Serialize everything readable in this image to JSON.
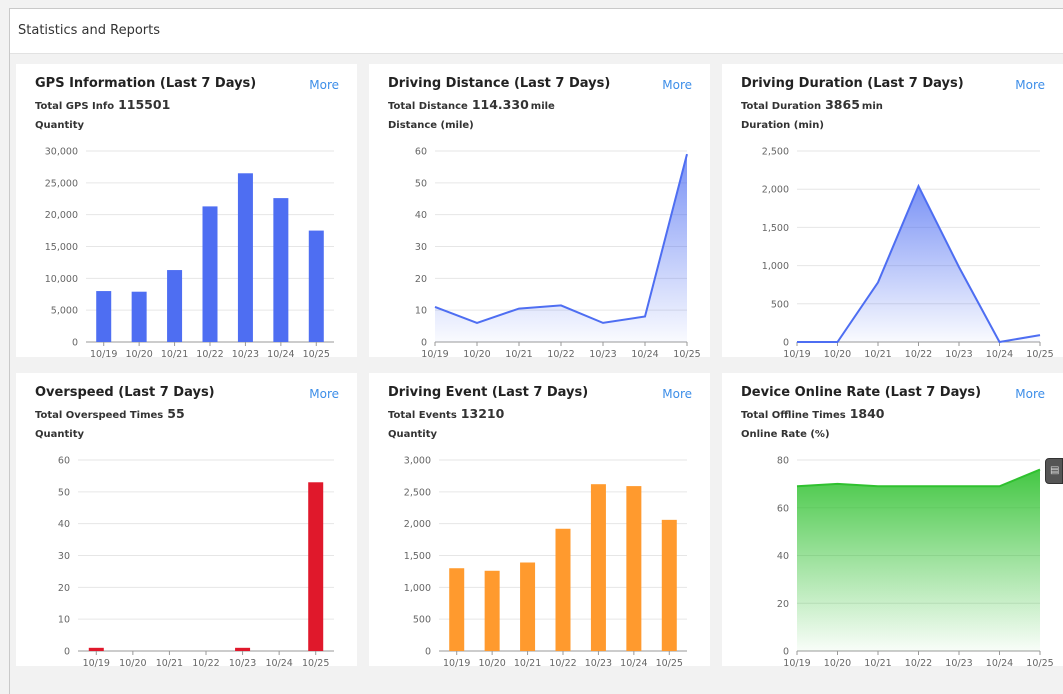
{
  "page": {
    "title": "Statistics and Reports",
    "side_button_icon": "▤"
  },
  "colors": {
    "blue": "#4e6ef2",
    "red": "#e0182b",
    "orange": "#ff9a2e",
    "green": "#2fc12f",
    "grid": "#e6e6e6",
    "axis": "#999999",
    "tick_text": "#666666"
  },
  "cards": [
    {
      "id": "gps",
      "title": "GPS Information (Last 7 Days)",
      "more": "More",
      "total_label": "Total GPS Info",
      "total_value": "115501",
      "total_unit": "",
      "ylabel": "Quantity"
    },
    {
      "id": "distance",
      "title": "Driving Distance (Last 7 Days)",
      "more": "More",
      "total_label": "Total Distance",
      "total_value": "114.330",
      "total_unit": "mile",
      "ylabel": "Distance (mile)"
    },
    {
      "id": "duration",
      "title": "Driving Duration (Last 7 Days)",
      "more": "More",
      "total_label": "Total Duration",
      "total_value": "3865",
      "total_unit": "min",
      "ylabel": "Duration (min)"
    },
    {
      "id": "overspeed",
      "title": "Overspeed (Last 7 Days)",
      "more": "More",
      "total_label": "Total Overspeed Times",
      "total_value": "55",
      "total_unit": "",
      "ylabel": "Quantity"
    },
    {
      "id": "event",
      "title": "Driving Event (Last 7 Days)",
      "more": "More",
      "total_label": "Total Events",
      "total_value": "13210",
      "total_unit": "",
      "ylabel": "Quantity"
    },
    {
      "id": "online",
      "title": "Device Online Rate (Last 7 Days)",
      "more": "More",
      "total_label": "Total Offline Times",
      "total_value": "1840",
      "total_unit": "",
      "ylabel": "Online Rate (%)"
    }
  ],
  "chart_data": [
    {
      "type": "bar",
      "categories": [
        "10/19",
        "10/20",
        "10/21",
        "10/22",
        "10/23",
        "10/24",
        "10/25"
      ],
      "values": [
        8000,
        7900,
        11300,
        21300,
        26500,
        22600,
        17500
      ],
      "ylim": [
        0,
        30000
      ],
      "yticks": [
        0,
        5000,
        10000,
        15000,
        20000,
        25000,
        30000
      ],
      "ytick_labels": [
        "0",
        "5,000",
        "10,000",
        "15,000",
        "20,000",
        "25,000",
        "30,000"
      ],
      "color": "#4e6ef2",
      "grid": true
    },
    {
      "type": "area",
      "categories": [
        "10/19",
        "10/20",
        "10/21",
        "10/22",
        "10/23",
        "10/24",
        "10/25"
      ],
      "values": [
        11,
        6,
        10.5,
        11.5,
        6,
        8,
        59
      ],
      "ylim": [
        0,
        60
      ],
      "yticks": [
        0,
        10,
        20,
        30,
        40,
        50,
        60
      ],
      "ytick_labels": [
        "0",
        "10",
        "20",
        "30",
        "40",
        "50",
        "60"
      ],
      "color": "#4e6ef2",
      "grid": true
    },
    {
      "type": "area",
      "categories": [
        "10/19",
        "10/20",
        "10/21",
        "10/22",
        "10/23",
        "10/24",
        "10/25"
      ],
      "values": [
        0,
        0,
        780,
        2040,
        980,
        0,
        90
      ],
      "ylim": [
        0,
        2500
      ],
      "yticks": [
        0,
        500,
        1000,
        1500,
        2000,
        2500
      ],
      "ytick_labels": [
        "0",
        "500",
        "1,000",
        "1,500",
        "2,000",
        "2,500"
      ],
      "color": "#4e6ef2",
      "grid": true
    },
    {
      "type": "bar",
      "categories": [
        "10/19",
        "10/20",
        "10/21",
        "10/22",
        "10/23",
        "10/24",
        "10/25"
      ],
      "values": [
        1,
        0,
        0,
        0,
        1,
        0,
        53
      ],
      "ylim": [
        0,
        60
      ],
      "yticks": [
        0,
        10,
        20,
        30,
        40,
        50,
        60
      ],
      "ytick_labels": [
        "0",
        "10",
        "20",
        "30",
        "40",
        "50",
        "60"
      ],
      "color": "#e0182b",
      "grid": true
    },
    {
      "type": "bar",
      "categories": [
        "10/19",
        "10/20",
        "10/21",
        "10/22",
        "10/23",
        "10/24",
        "10/25"
      ],
      "values": [
        1300,
        1260,
        1390,
        1920,
        2620,
        2590,
        2060
      ],
      "ylim": [
        0,
        3000
      ],
      "yticks": [
        0,
        500,
        1000,
        1500,
        2000,
        2500,
        3000
      ],
      "ytick_labels": [
        "0",
        "500",
        "1,000",
        "1,500",
        "2,000",
        "2,500",
        "3,000"
      ],
      "color": "#ff9a2e",
      "grid": true
    },
    {
      "type": "area",
      "categories": [
        "10/19",
        "10/20",
        "10/21",
        "10/22",
        "10/23",
        "10/24",
        "10/25"
      ],
      "values": [
        69,
        70,
        69,
        69,
        69,
        69,
        76
      ],
      "ylim": [
        0,
        80
      ],
      "yticks": [
        0,
        20,
        40,
        60,
        80
      ],
      "ytick_labels": [
        "0",
        "20",
        "40",
        "60",
        "80"
      ],
      "color": "#2fc12f",
      "grid": true
    }
  ]
}
